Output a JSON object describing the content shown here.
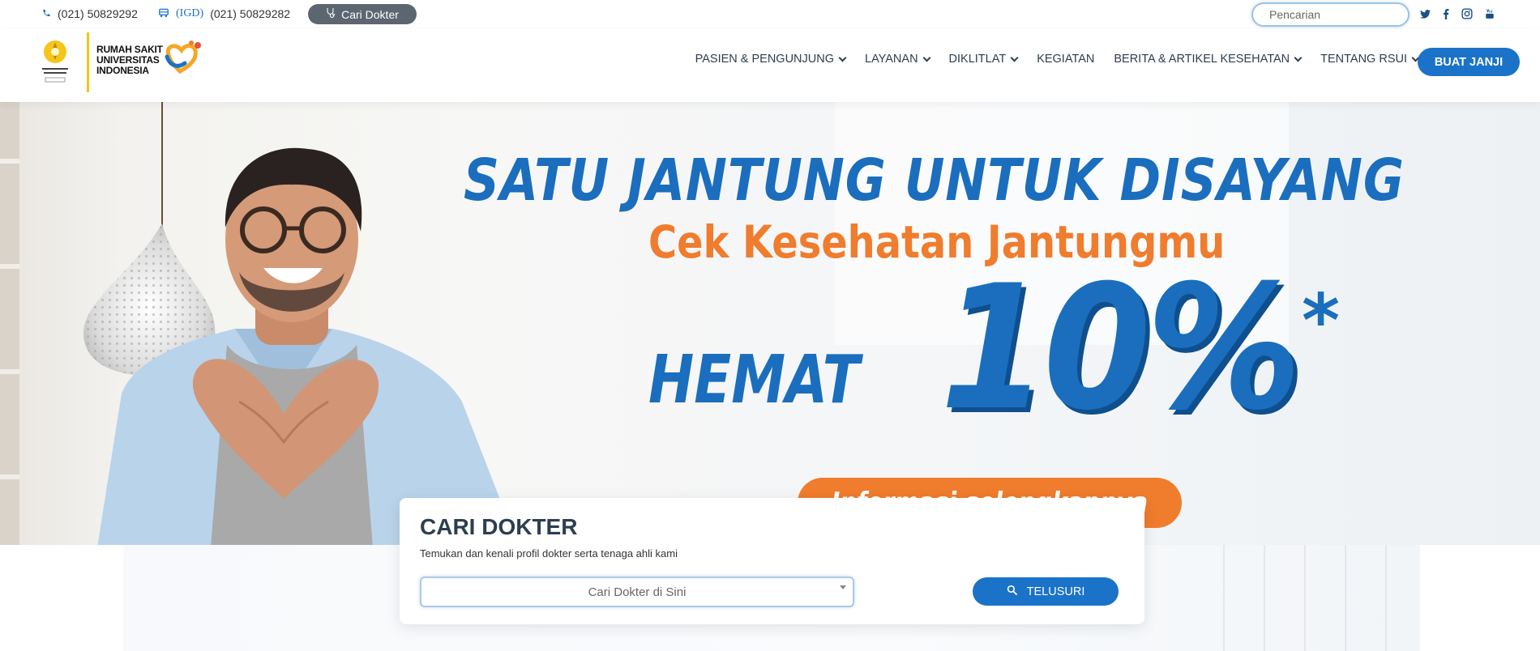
{
  "topbar": {
    "phone": "(021) 50829292",
    "igd_label": "(IGD)",
    "igd_phone": "(021) 50829282",
    "find_doctor_label": "Cari Dokter",
    "search_placeholder": "Pencarian",
    "socials": [
      "twitter-icon",
      "facebook-icon",
      "instagram-icon",
      "youtube-icon"
    ]
  },
  "logo": {
    "emblem_text": "UNIVERSITAS INDONESIA",
    "line1": "RUMAH SAKIT",
    "line2": "UNIVERSITAS",
    "line3": "INDONESIA"
  },
  "nav": {
    "items": [
      {
        "label": "PASIEN & PENGUNJUNG",
        "dropdown": true
      },
      {
        "label": "LAYANAN",
        "dropdown": true
      },
      {
        "label": "DIKLITLAT",
        "dropdown": true
      },
      {
        "label": "KEGIATAN",
        "dropdown": false
      },
      {
        "label": "BERITA & ARTIKEL KESEHATAN",
        "dropdown": true
      },
      {
        "label": "TENTANG RSUI",
        "dropdown": true
      }
    ],
    "cta_label": "BUAT JANJI"
  },
  "hero": {
    "title": "SATU JANTUNG UNTUK DISAYANG",
    "subtitle": "Cek Kesehatan Jantungmu",
    "save_label": "HEMAT",
    "percent": "10%",
    "asterisk": "*",
    "pill_text": "Informasi selengkapnya"
  },
  "search_card": {
    "title": "CARI DOKTER",
    "subtitle": "Temukan dan kenali profil dokter serta tenaga ahli kami",
    "select_placeholder": "Cari Dokter di Sini",
    "button_label": "TELUSURI"
  },
  "colors": {
    "primary": "#1a73c8",
    "accent_orange": "#f07c2d",
    "logo_yellow": "#f5c518",
    "text_dark": "#2c3e50"
  }
}
